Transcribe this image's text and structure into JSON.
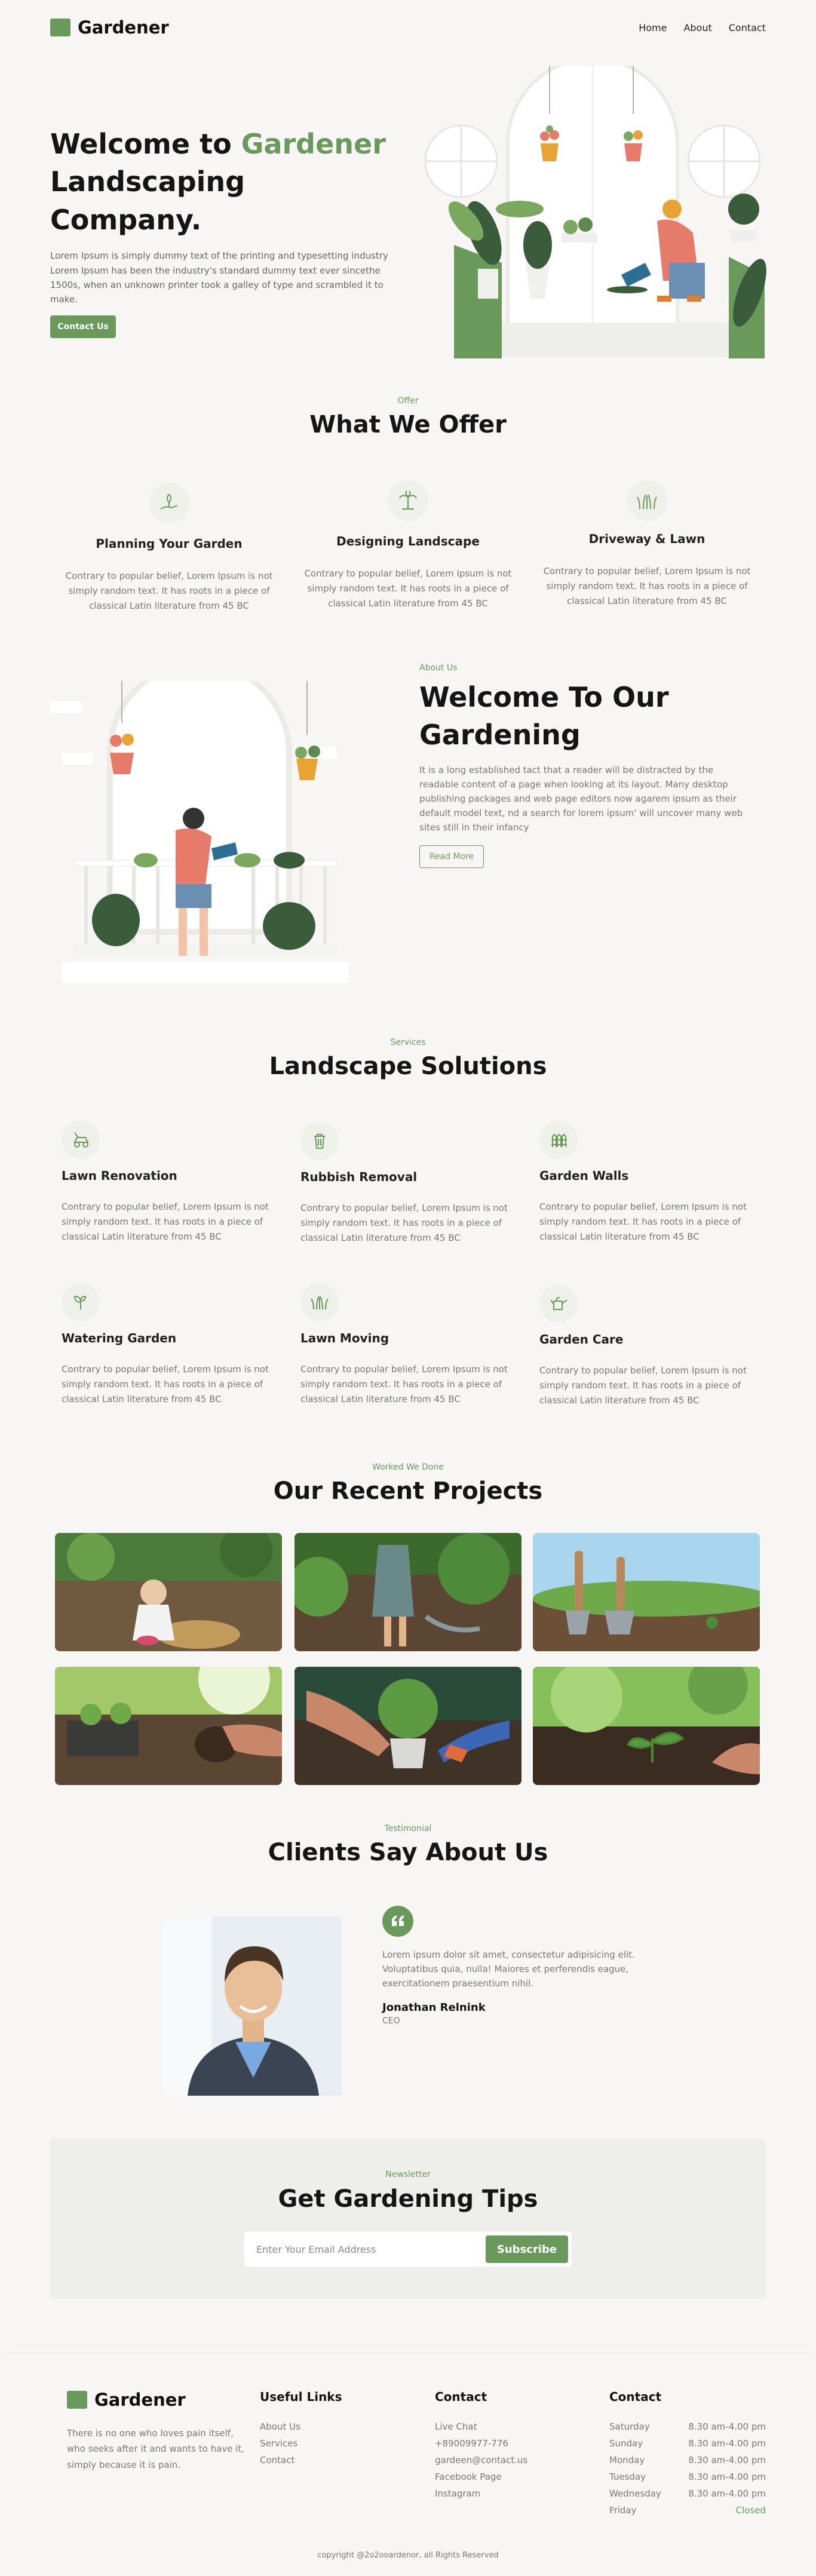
{
  "brand": {
    "name": "Gardener",
    "accent": "#6a9a5b"
  },
  "nav": {
    "items": [
      "Home",
      "About",
      "Contact"
    ]
  },
  "hero": {
    "title_prefix": "Welcome to ",
    "title_highlight": "Gardener",
    "title_line2": "Landscaping Company.",
    "description": "Lorem Ipsum is simply dummy text of the printing and typesetting industry Lorem Ipsum has been the industry's standard dummy text ever sincethe 1500s, when an unknown printer took a galley of type and scrambled it to make.",
    "button": "Contact Us"
  },
  "offer": {
    "label": "Offer",
    "title": "What We Offer",
    "items": [
      {
        "icon": "plant-hand-icon",
        "title": "Planning Your Garden",
        "desc": "Contrary to popular belief, Lorem Ipsum is not simply random text. It has roots in a piece of classical Latin literature from 45 BC"
      },
      {
        "icon": "palm-tree-icon",
        "title": "Designing Landscape",
        "desc": "Contrary to popular belief, Lorem Ipsum is not simply random text. It has roots in a piece of classical Latin literature from 45 BC"
      },
      {
        "icon": "grass-icon",
        "title": "Driveway & Lawn",
        "desc": "Contrary to popular belief, Lorem Ipsum is not simply random text. It has roots in a piece of classical Latin literature from 45 BC"
      }
    ]
  },
  "about": {
    "label": "About Us",
    "title": "Welcome To Our Gardening",
    "description": "It is a long established tact that a reader will be distracted by the readable content of a page when looking at its layout. Many desktop publishing packages and web page editors now agarem ipsum as their default model text, nd a search for lorem ipsum' will uncover many web sites still in their infancy",
    "button": "Read More"
  },
  "services": {
    "label": "Services",
    "title": "Landscape Solutions",
    "items": [
      {
        "icon": "lawn-mower-icon",
        "title": "Lawn Renovation",
        "desc": "Contrary to popular belief, Lorem Ipsum is not simply random text. It has roots in a piece of classical Latin literature from 45 BC"
      },
      {
        "icon": "trash-can-icon",
        "title": "Rubbish Removal",
        "desc": "Contrary to popular belief, Lorem Ipsum is not simply random text. It has roots in a piece of classical Latin literature from 45 BC"
      },
      {
        "icon": "garden-fence-icon",
        "title": "Garden Walls",
        "desc": "Contrary to popular belief, Lorem Ipsum is not simply random text. It has roots in a piece of classical Latin literature from 45 BC"
      },
      {
        "icon": "sprout-icon",
        "title": "Watering Garden",
        "desc": "Contrary to popular belief, Lorem Ipsum is not simply random text. It has roots in a piece of classical Latin literature from 45 BC"
      },
      {
        "icon": "grass-icon",
        "title": "Lawn Moving",
        "desc": "Contrary to popular belief, Lorem Ipsum is not simply random text. It has roots in a piece of classical Latin literature from 45 BC"
      },
      {
        "icon": "watering-can-icon",
        "title": "Garden Care",
        "desc": "Contrary to popular belief, Lorem Ipsum is not simply random text. It has roots in a piece of classical Latin literature from 45 BC"
      }
    ]
  },
  "projects": {
    "label": "Worked We Done",
    "title": "Our Recent Projects"
  },
  "testimonial": {
    "label": "Testimonial",
    "title": "Clients Say About Us",
    "quote": "Lorem ipsum dolor sit amet, consectetur adipisicing elit. Voluptatibus quia, nulla! Maiores et perferendis eague, exercitationem praesentium nihil.",
    "name": "Jonathan Relnink",
    "role": "CEO"
  },
  "newsletter": {
    "label": "Newsletter",
    "title": "Get Gardening Tips",
    "placeholder": "Enter Your Email Address",
    "button": "Subscribe"
  },
  "footer": {
    "about": "There is no one who loves pain itself, who seeks after it and wants to have it, simply because it is pain.",
    "useful_links": {
      "title": "Useful Links",
      "items": [
        "About Us",
        "Services",
        "Contact"
      ]
    },
    "contact": {
      "title": "Contact",
      "items": [
        "Live Chat",
        "+89009977-776",
        "gardeen@contact.us",
        "Facebook Page",
        "Instagram"
      ]
    },
    "hours": {
      "title": "Contact",
      "rows": [
        {
          "day": "Saturday",
          "time": "8.30 am-4.00 pm"
        },
        {
          "day": "Sunday",
          "time": "8.30 am-4.00 pm"
        },
        {
          "day": "Monday",
          "time": "8.30 am-4.00 pm"
        },
        {
          "day": "Tuesday",
          "time": "8.30 am-4.00 pm"
        },
        {
          "day": "Wednesday",
          "time": "8.30 am-4.00 pm"
        },
        {
          "day": "Friday",
          "time": "Closed"
        }
      ]
    },
    "copyright": "copyright @2o2ooardenor, all Rights Reserved"
  }
}
